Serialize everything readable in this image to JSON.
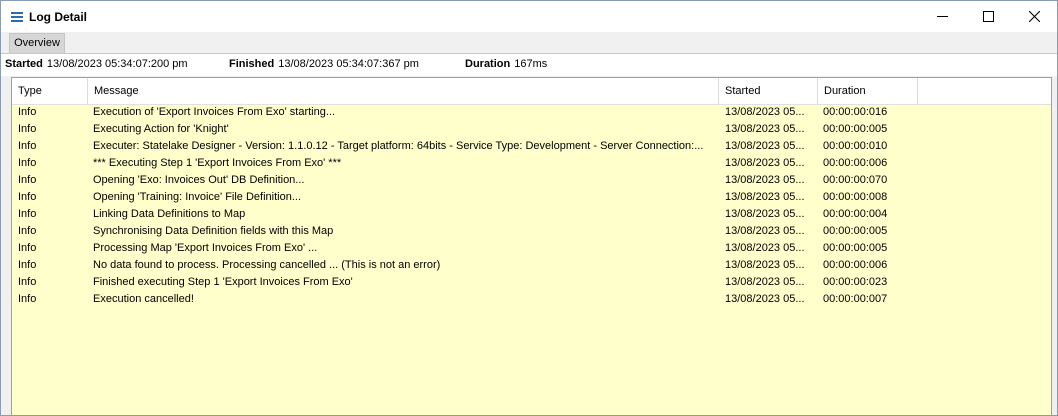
{
  "window": {
    "title": "Log Detail"
  },
  "tabs": [
    {
      "label": "Overview"
    }
  ],
  "summary": {
    "started_label": "Started",
    "started_value": "13/08/2023 05:34:07:200 pm",
    "finished_label": "Finished",
    "finished_value": "13/08/2023 05:34:07:367 pm",
    "duration_label": "Duration",
    "duration_value": "167ms"
  },
  "grid": {
    "columns": [
      "Type",
      "Message",
      "Started",
      "Duration"
    ],
    "rows": [
      {
        "type": "Info",
        "message": "Execution of 'Export Invoices From Exo' starting...",
        "started": "13/08/2023 05...",
        "duration": "00:00:00:016"
      },
      {
        "type": "Info",
        "message": "Executing Action for 'Knight'",
        "started": "13/08/2023 05...",
        "duration": "00:00:00:005"
      },
      {
        "type": "Info",
        "message": "Executer: Statelake Designer - Version: 1.1.0.12 - Target platform:  64bits - Service Type: Development - Server Connection:...",
        "started": "13/08/2023 05...",
        "duration": "00:00:00:010"
      },
      {
        "type": "Info",
        "message": "*** Executing Step 1 'Export Invoices From Exo' ***",
        "started": "13/08/2023 05...",
        "duration": "00:00:00:006"
      },
      {
        "type": "Info",
        "message": "Opening 'Exo: Invoices Out' DB Definition...",
        "started": "13/08/2023 05...",
        "duration": "00:00:00:070"
      },
      {
        "type": "Info",
        "message": "Opening 'Training: Invoice' File Definition...",
        "started": "13/08/2023 05...",
        "duration": "00:00:00:008"
      },
      {
        "type": "Info",
        "message": "Linking Data Definitions to Map",
        "started": "13/08/2023 05...",
        "duration": "00:00:00:004"
      },
      {
        "type": "Info",
        "message": "Synchronising Data Definition fields with this Map",
        "started": "13/08/2023 05...",
        "duration": "00:00:00:005"
      },
      {
        "type": "Info",
        "message": "Processing Map 'Export Invoices From Exo' ...",
        "started": "13/08/2023 05...",
        "duration": "00:00:00:005"
      },
      {
        "type": "Info",
        "message": "No data found to process.  Processing cancelled ... (This is not an error)",
        "started": "13/08/2023 05...",
        "duration": "00:00:00:006"
      },
      {
        "type": "Info",
        "message": "Finished executing Step 1 'Export Invoices From Exo'",
        "started": "13/08/2023 05...",
        "duration": "00:00:00:023"
      },
      {
        "type": "Info",
        "message": "Execution cancelled!",
        "started": "13/08/2023 05...",
        "duration": "00:00:00:007"
      }
    ]
  },
  "icons": {
    "app": "menu-lines-icon",
    "minimize": "minimize-icon",
    "maximize": "maximize-icon",
    "close": "close-icon"
  },
  "colors": {
    "grid_background": "#ffffcc",
    "app_icon": "#2b6cb0"
  }
}
